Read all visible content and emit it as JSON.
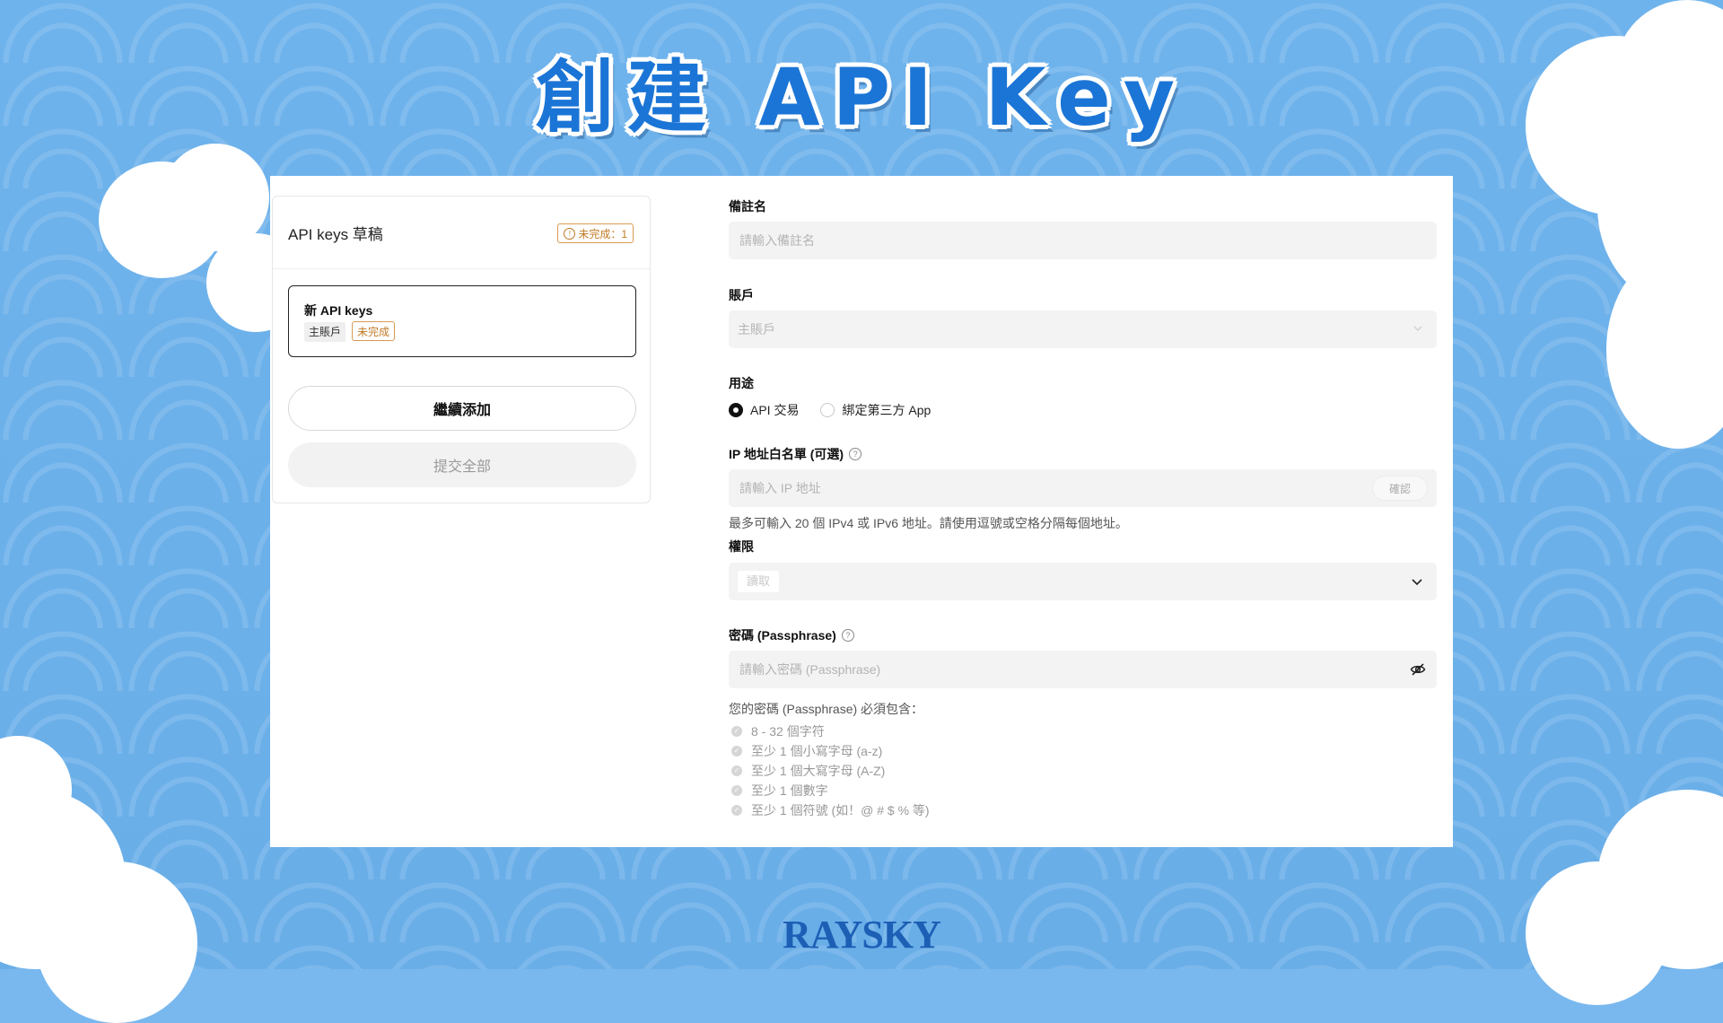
{
  "title": "創建 API Key",
  "drafts": {
    "title": "API keys 草稿",
    "status_badge": "未完成：1",
    "item": {
      "title": "新 API keys",
      "account_tag": "主賬戶",
      "status_tag": "未完成"
    },
    "continue_label": "繼續添加",
    "submit_label": "提交全部"
  },
  "form": {
    "remark": {
      "label": "備註名",
      "placeholder": "請輸入備註名"
    },
    "account": {
      "label": "賬戶",
      "value": "主賬戶"
    },
    "usage": {
      "label": "用途",
      "options": [
        {
          "label": "API 交易",
          "selected": true
        },
        {
          "label": "綁定第三方 App",
          "selected": false
        }
      ]
    },
    "ip_whitelist": {
      "label": "IP 地址白名單 (可選)",
      "placeholder": "請輸入 IP 地址",
      "confirm_label": "確認",
      "hint": "最多可輸入 20 個 IPv4 或 IPv6 地址。請使用逗號或空格分隔每個地址。"
    },
    "permission": {
      "label": "權限",
      "chip": "讀取"
    },
    "passphrase": {
      "label": "密碼 (Passphrase)",
      "placeholder": "請輸入密碼 (Passphrase)",
      "requirements_title": "您的密碼 (Passphrase) 必須包含：",
      "requirements": [
        "8 - 32 個字符",
        "至少 1 個小寫字母 (a-z)",
        "至少 1 個大寫字母 (A-Z)",
        "至少 1 個數字",
        "至少 1 個符號 (如！@ # $ % 等)"
      ]
    }
  },
  "logo": "RAYSKY",
  "colors": {
    "accent": "#1b75d6",
    "warning": "#c07a25",
    "background": "#6fb3ec"
  }
}
